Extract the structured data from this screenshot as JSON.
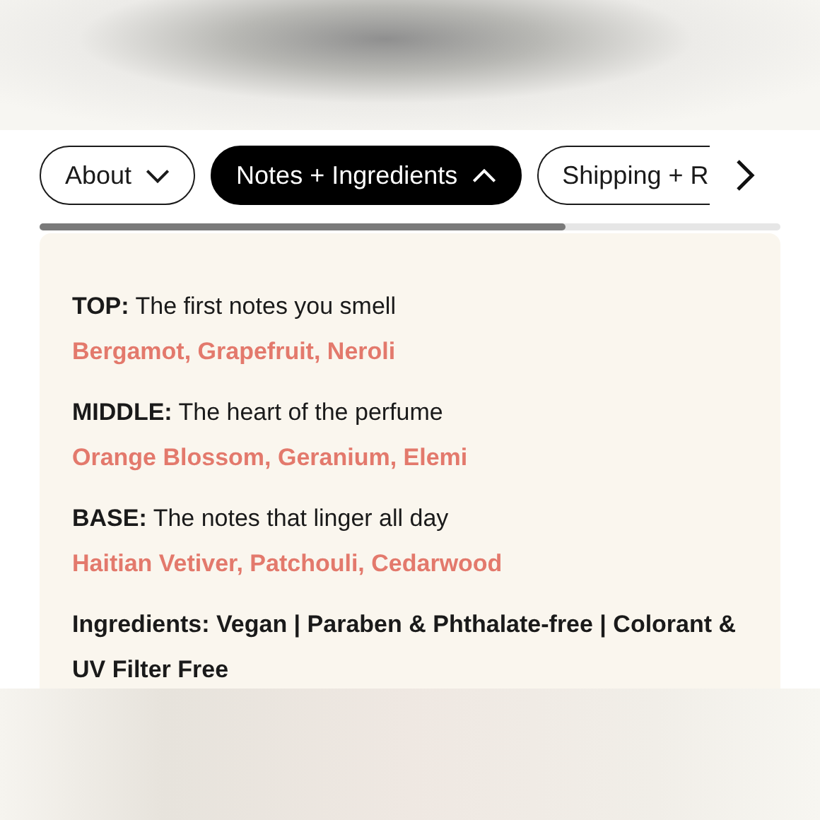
{
  "tabs": [
    {
      "label": "About",
      "selected": false,
      "expanded": false
    },
    {
      "label": "Notes + Ingredients",
      "selected": true,
      "expanded": true
    },
    {
      "label": "Shipping + R",
      "selected": false
    }
  ],
  "notes": [
    {
      "tier": "TOP:",
      "description": "The first notes you smell",
      "notes": "Bergamot, Grapefruit, Neroli"
    },
    {
      "tier": "MIDDLE:",
      "description": "The heart of the perfume",
      "notes": "Orange Blossom, Geranium, Elemi"
    },
    {
      "tier": "BASE:",
      "description": "The notes that linger all day",
      "notes": "Haitian Vetiver, Patchouli, Cedarwood"
    }
  ],
  "ingredients": "Ingredients: Vegan | Paraben & Phthalate-free | Colorant & UV Filter Free"
}
